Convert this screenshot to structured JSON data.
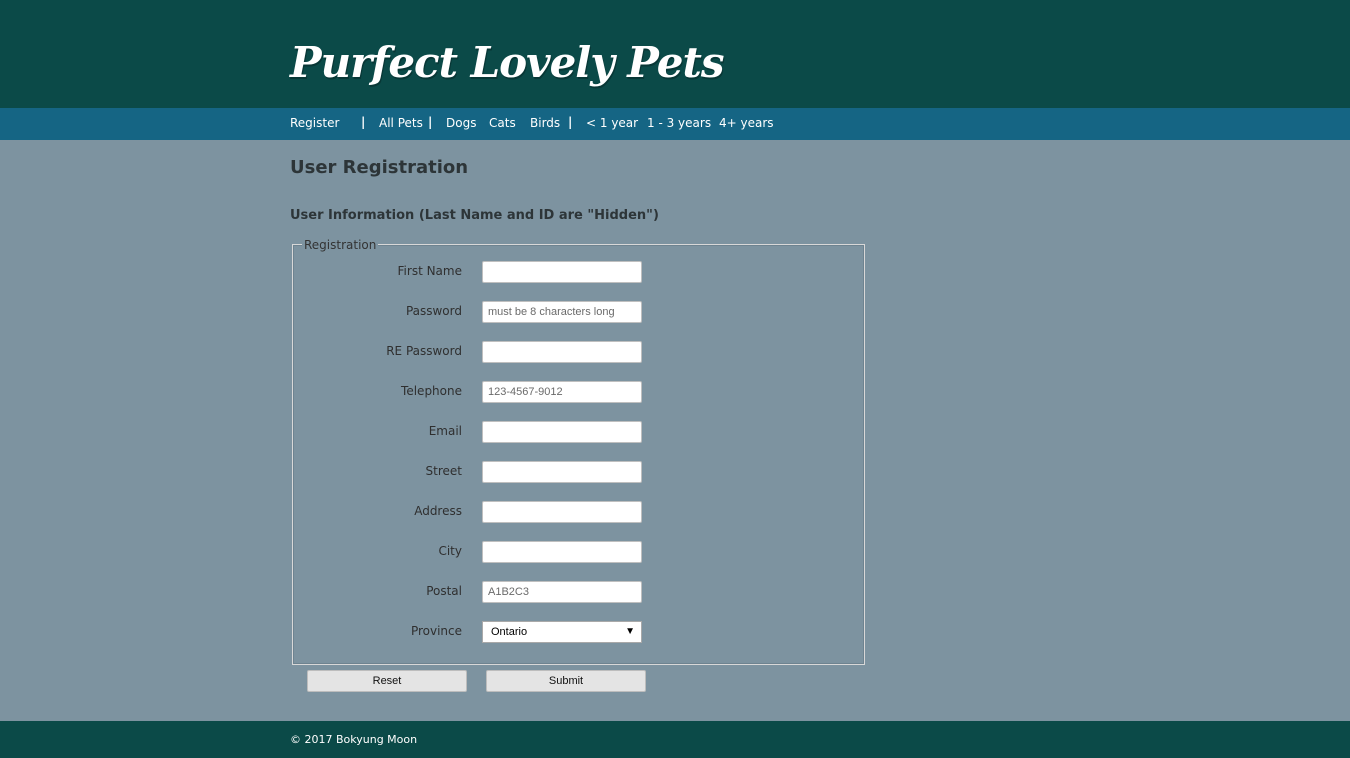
{
  "site": {
    "title": "Purfect Lovely Pets"
  },
  "nav": {
    "items": [
      {
        "label": "Register"
      },
      {
        "label": "All Pets"
      },
      {
        "label": "Dogs"
      },
      {
        "label": "Cats"
      },
      {
        "label": "Birds"
      },
      {
        "label": "< 1 year"
      },
      {
        "label": "1 - 3 years"
      },
      {
        "label": "4+ years"
      }
    ],
    "separator": "|"
  },
  "page": {
    "title": "User Registration",
    "section": "User Information (Last Name and ID are \"Hidden\")"
  },
  "form": {
    "legend": "Registration",
    "fields": [
      {
        "label": "First Name",
        "value": "",
        "placeholder": ""
      },
      {
        "label": "Password",
        "value": "",
        "placeholder": "must be 8 characters long"
      },
      {
        "label": "RE Password",
        "value": "",
        "placeholder": ""
      },
      {
        "label": "Telephone",
        "value": "",
        "placeholder": "123-4567-9012"
      },
      {
        "label": "Email",
        "value": "",
        "placeholder": ""
      },
      {
        "label": "Street",
        "value": "",
        "placeholder": ""
      },
      {
        "label": "Address",
        "value": "",
        "placeholder": ""
      },
      {
        "label": "City",
        "value": "",
        "placeholder": ""
      },
      {
        "label": "Postal",
        "value": "",
        "placeholder": "A1B2C3"
      }
    ],
    "province": {
      "label": "Province",
      "selected": "Ontario",
      "arrow_icon": "triangle-down"
    },
    "reset_label": "Reset",
    "submit_label": "Submit"
  },
  "footer": {
    "text": "© 2017 Bokyung Moon"
  },
  "colors": {
    "header_bg": "#0b4a48",
    "nav_bg": "#156584",
    "page_bg": "#7d93a0",
    "footer_bg": "#0b4a48"
  }
}
